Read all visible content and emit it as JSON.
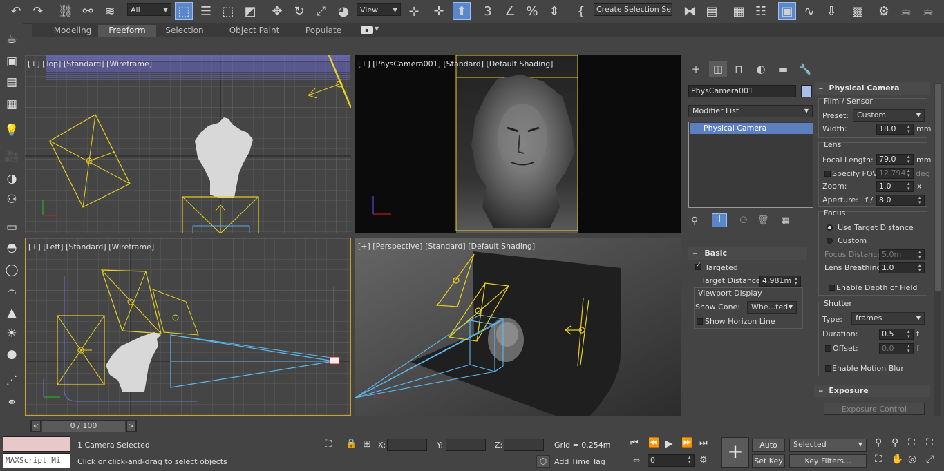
{
  "toolbar": {
    "selection_filter": "All",
    "ref_coord": "View",
    "selection_set_placeholder": "Create Selection Se"
  },
  "ribbon": {
    "tabs": [
      "Modeling",
      "Freeform",
      "Selection",
      "Object Paint",
      "Populate"
    ],
    "active_tab": "Freeform"
  },
  "viewports": {
    "top": {
      "label": "[+] [Top] [Standard] [Wireframe]"
    },
    "camera": {
      "label": "[+] [PhysCamera001] [Standard] [Default Shading]"
    },
    "left": {
      "label": "[+] [Left] [Standard] [Wireframe]"
    },
    "perspective": {
      "label": "[+] [Perspective] [Standard] [Default Shading]"
    }
  },
  "command_panel": {
    "object_name": "PhysCamera001",
    "object_color": "#a8c0ee",
    "modifier_list": "Modifier List",
    "stack_items": [
      "Physical Camera"
    ],
    "basic": {
      "title": "Basic",
      "targeted_label": "Targeted",
      "targeted": true,
      "target_distance_label": "Target Distance:",
      "target_distance": "4.981m",
      "viewport_display_title": "Viewport Display",
      "show_cone_label": "Show Cone:",
      "show_cone_value": "Whe...ted",
      "show_horizon_label": "Show Horizon Line"
    }
  },
  "physical_camera": {
    "title": "Physical Camera",
    "film_sensor": {
      "title": "Film / Sensor",
      "preset_label": "Preset:",
      "preset_value": "Custom",
      "width_label": "Width:",
      "width_value": "18.0",
      "width_unit": "mm"
    },
    "lens": {
      "title": "Lens",
      "focal_length_label": "Focal Length:",
      "focal_length_value": "79.0",
      "focal_length_unit": "mm",
      "specify_fov_label": "Specify FOV:",
      "fov_value": "12.794",
      "fov_unit": "deg",
      "zoom_label": "Zoom:",
      "zoom_value": "1.0",
      "zoom_unit": "x",
      "aperture_label": "Aperture:",
      "aperture_prefix": "f /",
      "aperture_value": "8.0"
    },
    "focus": {
      "title": "Focus",
      "use_target_label": "Use Target Distance",
      "custom_label": "Custom",
      "focus_distance_label": "Focus Distance:",
      "focus_distance_value": "5.0m",
      "lens_breathing_label": "Lens Breathing:",
      "lens_breathing_value": "1.0",
      "enable_dof_label": "Enable Depth of Field"
    },
    "shutter": {
      "title": "Shutter",
      "type_label": "Type:",
      "type_value": "frames",
      "duration_label": "Duration:",
      "duration_value": "0.5",
      "duration_unit": "f",
      "offset_label": "Offset:",
      "offset_value": "0.0",
      "offset_unit": "f",
      "enable_motion_blur_label": "Enable Motion Blur"
    },
    "exposure": {
      "title": "Exposure",
      "button_label": "Exposure Control Installed"
    }
  },
  "timeline": {
    "frame_label": "0 / 100",
    "prev": "<",
    "next": ">"
  },
  "status": {
    "maxscript_placeholder": "MAXScript Mi",
    "selection_info": "1 Camera Selected",
    "prompt": "Click or click-and-drag to select objects",
    "x_label": "X:",
    "y_label": "Y:",
    "z_label": "Z:",
    "grid": "Grid = 0.254m",
    "add_time_tag": "Add Time Tag",
    "auto_key": "Auto Key",
    "set_key": "Set Key",
    "selected": "Selected",
    "key_filters": "Key Filters...",
    "frame": "0"
  }
}
